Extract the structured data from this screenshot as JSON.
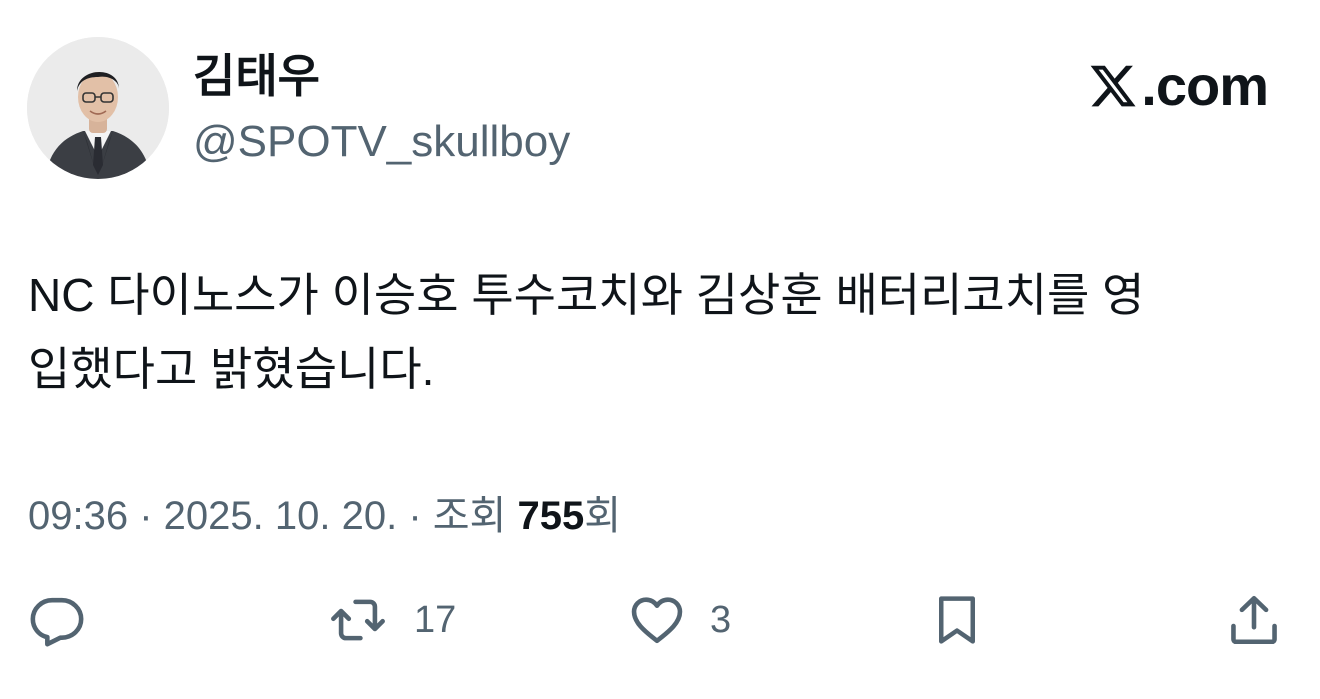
{
  "post": {
    "author": {
      "display_name": "김태우",
      "handle": "@SPOTV_skullboy"
    },
    "brand": {
      "text": ".com",
      "icon": "x-logo-icon"
    },
    "text": "NC 다이노스가 이승호 투수코치와 김상훈 배터리코치를 영\n입했다고 밝혔습니다.",
    "meta": {
      "time": "09:36",
      "separator": " · ",
      "date": "2025. 10. 20.",
      "views_label": "조회 ",
      "views_count": "755",
      "views_suffix": "회"
    },
    "actions": {
      "reply": {
        "icon": "reply-icon",
        "count": ""
      },
      "repost": {
        "icon": "repost-icon",
        "count": "17"
      },
      "like": {
        "icon": "heart-icon",
        "count": "3"
      },
      "bookmark": {
        "icon": "bookmark-icon"
      },
      "share": {
        "icon": "share-icon"
      }
    }
  },
  "colors": {
    "text_primary": "#0f1419",
    "text_secondary": "#536471",
    "background": "#ffffff"
  }
}
